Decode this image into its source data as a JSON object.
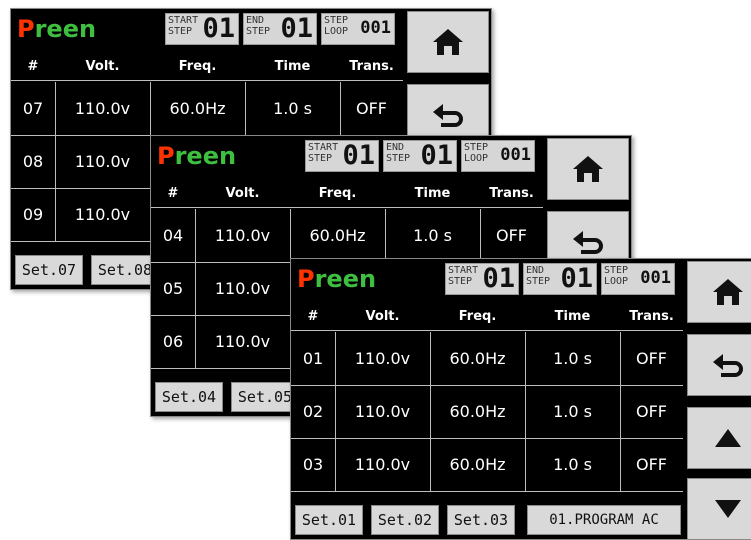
{
  "brand": {
    "first": "P",
    "rest": "reen"
  },
  "labels": {
    "start": "START\nSTEP",
    "end": "END\nSTEP",
    "loop": "STEP\nLOOP"
  },
  "headers": [
    "#",
    "Volt.",
    "Freq.",
    "Time",
    "Trans."
  ],
  "screens": [
    {
      "start_step": "01",
      "end_step": "01",
      "step_loop": "001",
      "rows": [
        {
          "num": "07",
          "volt": "110.0v",
          "freq": "60.0Hz",
          "time": "1.0 s",
          "trans": "OFF"
        },
        {
          "num": "08",
          "volt": "110.0v",
          "freq": "",
          "time": "",
          "trans": ""
        },
        {
          "num": "09",
          "volt": "110.0v",
          "freq": "",
          "time": "",
          "trans": ""
        }
      ],
      "footer": [
        "Set.07",
        "Set.08",
        "",
        ""
      ]
    },
    {
      "start_step": "01",
      "end_step": "01",
      "step_loop": "001",
      "rows": [
        {
          "num": "04",
          "volt": "110.0v",
          "freq": "60.0Hz",
          "time": "1.0 s",
          "trans": "OFF"
        },
        {
          "num": "05",
          "volt": "110.0v",
          "freq": "",
          "time": "",
          "trans": ""
        },
        {
          "num": "06",
          "volt": "110.0v",
          "freq": "",
          "time": "",
          "trans": ""
        }
      ],
      "footer": [
        "Set.04",
        "Set.05",
        "",
        ""
      ]
    },
    {
      "start_step": "01",
      "end_step": "01",
      "step_loop": "001",
      "rows": [
        {
          "num": "01",
          "volt": "110.0v",
          "freq": "60.0Hz",
          "time": "1.0 s",
          "trans": "OFF"
        },
        {
          "num": "02",
          "volt": "110.0v",
          "freq": "60.0Hz",
          "time": "1.0 s",
          "trans": "OFF"
        },
        {
          "num": "03",
          "volt": "110.0v",
          "freq": "60.0Hz",
          "time": "1.0 s",
          "trans": "OFF"
        }
      ],
      "footer": [
        "Set.01",
        "Set.02",
        "Set.03",
        "01.PROGRAM AC"
      ]
    }
  ],
  "icons": {
    "home": "home-icon",
    "back": "back-arrow-icon",
    "up": "up-triangle-icon",
    "down": "down-triangle-icon"
  }
}
